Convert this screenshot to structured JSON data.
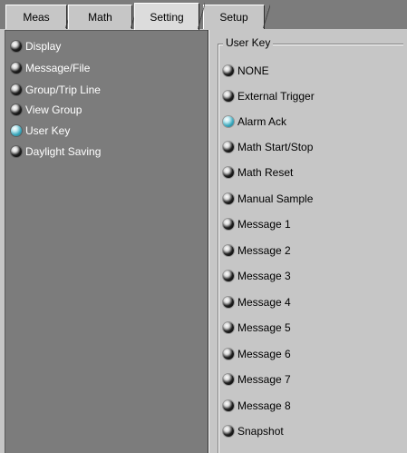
{
  "tabs": [
    {
      "label": "Meas",
      "active": false
    },
    {
      "label": "Math",
      "active": false
    },
    {
      "label": "Setting",
      "active": true
    },
    {
      "label": "Setup",
      "active": false
    }
  ],
  "sidebar": {
    "items": [
      {
        "label": "Display",
        "selected": false
      },
      {
        "label": "Message/File",
        "selected": false
      },
      {
        "label": "Group/Trip Line",
        "selected": false
      },
      {
        "label": "View Group",
        "selected": false
      },
      {
        "label": "User Key",
        "selected": true
      },
      {
        "label": "Daylight Saving",
        "selected": false
      }
    ]
  },
  "user_key": {
    "title": "User Key",
    "options": [
      {
        "label": "NONE",
        "selected": false
      },
      {
        "label": "External Trigger",
        "selected": false
      },
      {
        "label": "Alarm Ack",
        "selected": true
      },
      {
        "label": "Math Start/Stop",
        "selected": false
      },
      {
        "label": "Math Reset",
        "selected": false
      },
      {
        "label": "Manual Sample",
        "selected": false
      },
      {
        "label": "Message 1",
        "selected": false
      },
      {
        "label": "Message 2",
        "selected": false
      },
      {
        "label": "Message 3",
        "selected": false
      },
      {
        "label": "Message 4",
        "selected": false
      },
      {
        "label": "Message 5",
        "selected": false
      },
      {
        "label": "Message 6",
        "selected": false
      },
      {
        "label": "Message 7",
        "selected": false
      },
      {
        "label": "Message 8",
        "selected": false
      },
      {
        "label": "Snapshot",
        "selected": false
      }
    ]
  },
  "colors": {
    "background": "#c6c6c6",
    "nav_background": "#7c7c7c",
    "tab_active": "#dcdcdc",
    "lamp_selected": "#3aa8bd",
    "lamp_unselected": "#202020"
  }
}
